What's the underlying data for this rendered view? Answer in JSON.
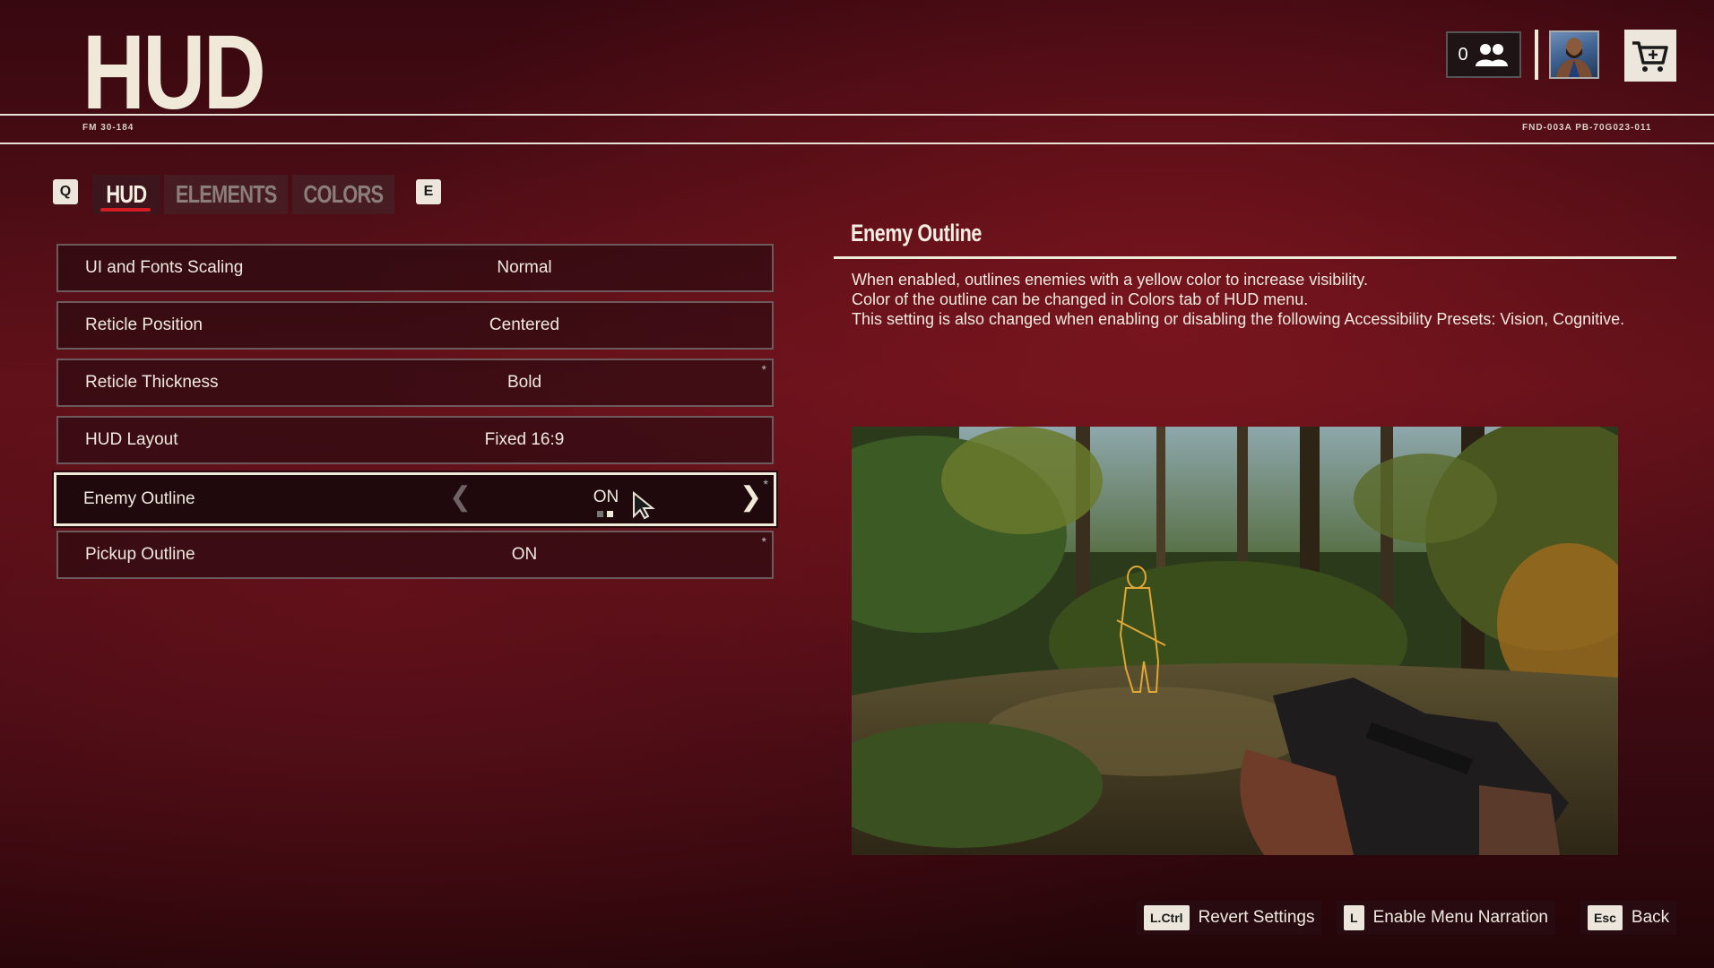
{
  "header": {
    "title": "HUD",
    "code_left": "FM 30-184",
    "code_right": "FND-003A PB-70G023-011",
    "friends_count": "0"
  },
  "tabs": {
    "prev_key": "Q",
    "next_key": "E",
    "items": [
      {
        "label": "HUD",
        "active": true
      },
      {
        "label": "ELEMENTS",
        "active": false
      },
      {
        "label": "COLORS",
        "active": false
      }
    ]
  },
  "settings": [
    {
      "label": "UI and Fonts Scaling",
      "value": "Normal",
      "starred": false
    },
    {
      "label": "Reticle Position",
      "value": "Centered",
      "starred": false
    },
    {
      "label": "Reticle Thickness",
      "value": "Bold",
      "starred": true
    },
    {
      "label": "HUD Layout",
      "value": "Fixed 16:9",
      "starred": false
    },
    {
      "label": "Enemy Outline",
      "value": "ON",
      "starred": true,
      "selected": true,
      "option_index": 2,
      "option_count": 2
    },
    {
      "label": "Pickup Outline",
      "value": "ON",
      "starred": true
    }
  ],
  "star_symbol": "*",
  "detail": {
    "title": "Enemy Outline",
    "lines": [
      "When enabled, outlines enemies with a yellow color to increase visibility.",
      "Color of the outline can be changed in Colors tab of HUD menu.",
      "This setting is also changed when enabling or disabling the following Accessibility Presets: Vision, Cognitive."
    ]
  },
  "footer": [
    {
      "key": "L.Ctrl",
      "label": "Revert Settings"
    },
    {
      "key": "L",
      "label": "Enable Menu Narration"
    },
    {
      "key": "Esc",
      "label": "Back"
    }
  ],
  "colors": {
    "accent_red": "#d41c22",
    "text_cream": "#f0ead8"
  }
}
